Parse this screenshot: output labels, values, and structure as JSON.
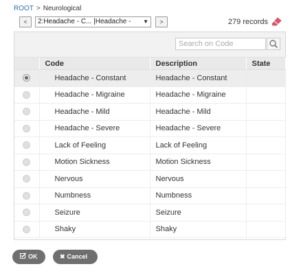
{
  "breadcrumb": {
    "root": "ROOT",
    "separator": ">",
    "current": "Neurological"
  },
  "navigation": {
    "prev_label": "<",
    "next_label": ">",
    "selected_option": "2:Headache - C... |Headache -",
    "caret": "▼"
  },
  "records_count": "279 records",
  "search": {
    "placeholder": "Search on Code"
  },
  "table": {
    "columns": [
      "",
      "Code",
      "Description",
      "State"
    ],
    "rows": [
      {
        "code": "Headache - Constant",
        "description": "Headache - Constant",
        "state": "",
        "selected": true
      },
      {
        "code": "Headache - Migraine",
        "description": "Headache - Migraine",
        "state": "",
        "selected": false
      },
      {
        "code": "Headache - Mild",
        "description": "Headache - Mild",
        "state": "",
        "selected": false
      },
      {
        "code": "Headache - Severe",
        "description": "Headache - Severe",
        "state": "",
        "selected": false
      },
      {
        "code": "Lack of Feeling",
        "description": "Lack of Feeling",
        "state": "",
        "selected": false
      },
      {
        "code": "Motion Sickness",
        "description": "Motion Sickness",
        "state": "",
        "selected": false
      },
      {
        "code": "Nervous",
        "description": "Nervous",
        "state": "",
        "selected": false
      },
      {
        "code": "Numbness",
        "description": "Numbness",
        "state": "",
        "selected": false
      },
      {
        "code": "Seizure",
        "description": "Seizure",
        "state": "",
        "selected": false
      },
      {
        "code": "Shaky",
        "description": "Shaky",
        "state": "",
        "selected": false
      }
    ]
  },
  "footer": {
    "ok_label": "OK",
    "cancel_label": "Cancel"
  },
  "icons": {
    "eraser": "eraser-icon",
    "search": "search-icon",
    "ok": "checkbox-edit-icon",
    "cancel": "close-icon"
  },
  "colors": {
    "link": "#2a6ebb",
    "eraser": "#e05a6a",
    "button": "#6f6f6f"
  }
}
